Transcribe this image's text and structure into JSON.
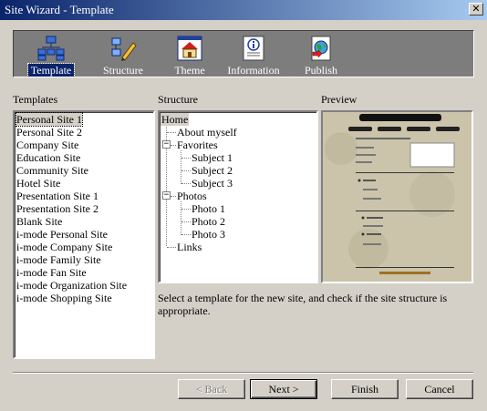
{
  "window": {
    "title": "Site Wizard - Template",
    "close_glyph": "✕"
  },
  "toolbar": {
    "items": [
      {
        "label": "Template",
        "icon": "sitemap-icon",
        "selected": true
      },
      {
        "label": "Structure",
        "icon": "structure-pencil-icon",
        "selected": false
      },
      {
        "label": "Theme",
        "icon": "house-theme-icon",
        "selected": false
      },
      {
        "label": "Information",
        "icon": "info-page-icon",
        "selected": false
      },
      {
        "label": "Publish",
        "icon": "globe-publish-icon",
        "selected": false
      }
    ]
  },
  "templates": {
    "label": "Templates",
    "items": [
      "Personal Site 1",
      "Personal Site 2",
      "Company Site",
      "Education Site",
      "Community Site",
      "Hotel Site",
      "Presentation Site 1",
      "Presentation Site 2",
      "Blank Site",
      "i-mode Personal Site",
      "i-mode Company Site",
      "i-mode Family Site",
      "i-mode Fan Site",
      "i-mode Organization Site",
      "i-mode Shopping Site"
    ],
    "selected": "Personal Site 1"
  },
  "structure": {
    "label": "Structure",
    "nodes": {
      "home": "Home",
      "about": "About myself",
      "favorites": "Favorites",
      "subject1": "Subject 1",
      "subject2": "Subject 2",
      "subject3": "Subject 3",
      "photos": "Photos",
      "photo1": "Photo 1",
      "photo2": "Photo 2",
      "photo3": "Photo 3",
      "links": "Links"
    },
    "collapse_glyph": "−"
  },
  "preview": {
    "label": "Preview"
  },
  "hint": "Select a template for the new site, and check if the site structure is appropriate.",
  "buttons": {
    "back": "< Back",
    "next": "Next >",
    "finish": "Finish",
    "cancel": "Cancel"
  },
  "colors": {
    "titlebar_start": "#0a246a",
    "titlebar_end": "#a6caf0",
    "face": "#d4d0c8",
    "toolbar_bg": "#7d7d7d"
  }
}
